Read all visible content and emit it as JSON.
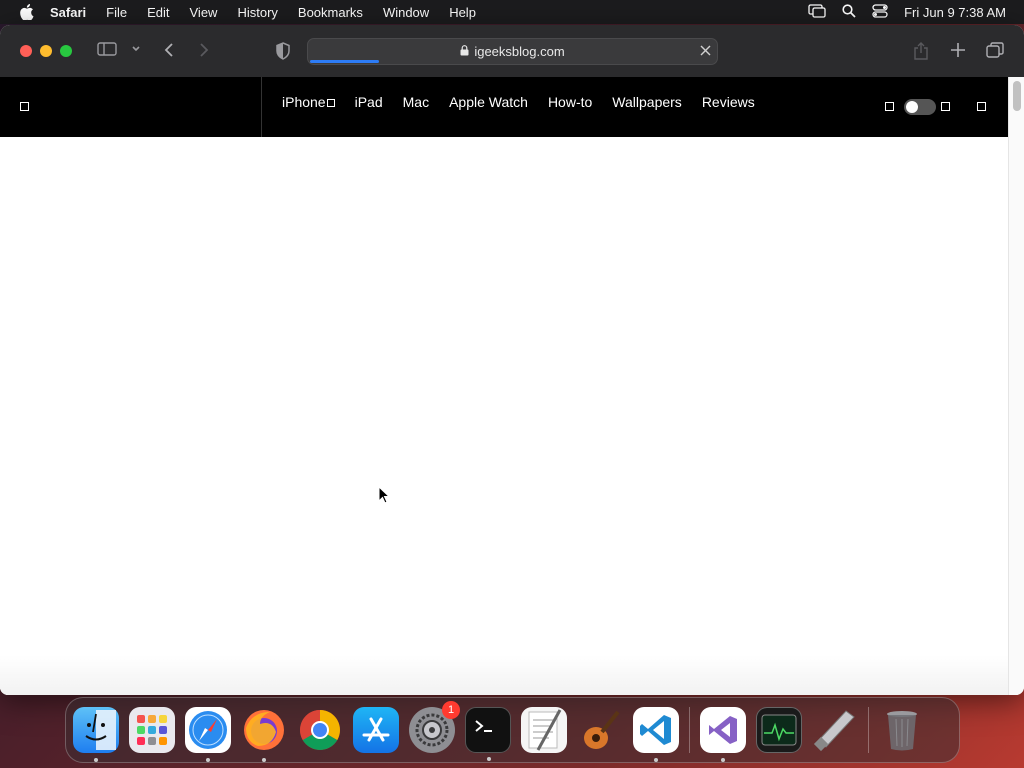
{
  "menubar": {
    "app_name": "Safari",
    "items": [
      "File",
      "Edit",
      "View",
      "History",
      "Bookmarks",
      "Window",
      "Help"
    ],
    "clock": "Fri Jun 9  7:38 AM"
  },
  "browser": {
    "url": "igeeksblog.com",
    "page_load_progress": 0.17
  },
  "site": {
    "nav_links": [
      "iPhone",
      "iPad",
      "Mac",
      "Apple Watch",
      "How-to",
      "Wallpapers",
      "Reviews"
    ]
  },
  "dock": {
    "apps": [
      "finder-icon",
      "launchpad-icon",
      "safari-icon",
      "firefox-icon",
      "chrome-icon",
      "app-store-icon",
      "system-settings-icon",
      "terminal-icon",
      "textedit-icon",
      "garageband-icon",
      "vscode-icon",
      "visual-studio-icon",
      "activity-monitor-icon",
      "xcode-instruments-icon",
      "trash-icon"
    ],
    "settings_badge": "1"
  },
  "colors": {
    "accent": "#2d7cf6",
    "close": "#ff5f57",
    "minimize": "#febc2e",
    "maximize": "#28c840"
  }
}
